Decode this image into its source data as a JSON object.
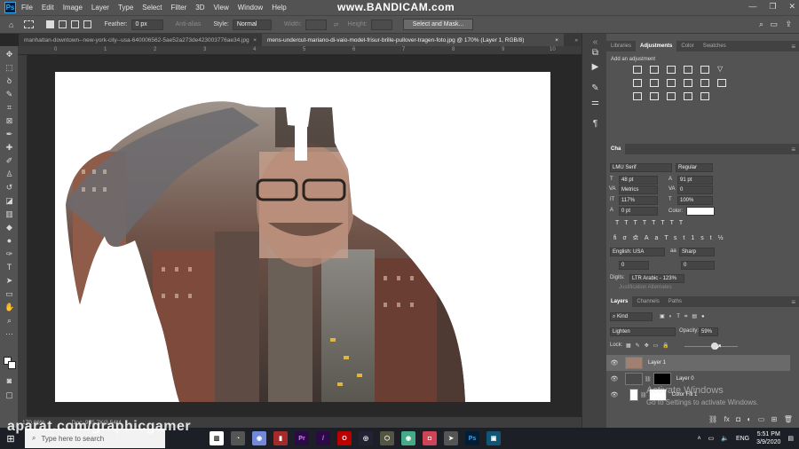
{
  "menubar": {
    "items": [
      "File",
      "Edit",
      "Image",
      "Layer",
      "Type",
      "Select",
      "Filter",
      "3D",
      "View",
      "Window",
      "Help"
    ],
    "recording_banner": "www.BANDICAM.com"
  },
  "options": {
    "feather_label": "Feather:",
    "feather_value": "0 px",
    "antialias_label": "Anti-alias",
    "style_label": "Style:",
    "style_value": "Normal",
    "width_label": "Width:",
    "height_label": "Height:",
    "select_mask_label": "Select and Mask..."
  },
  "tabs": [
    {
      "label": "manhattan-downtown--new-york-city--usa-640006562-5ae52a273de423003776ae34.jpg",
      "close": "×"
    },
    {
      "label": "mens-undercut-mariano-di-vaio-model-frisur-brille-pullover-tragen-foto.jpg @ 170% (Layer 1, RGB/8)",
      "close": "×"
    }
  ],
  "ruler": {
    "ticks": [
      "0",
      "1",
      "2",
      "3",
      "4",
      "5",
      "6",
      "7",
      "8",
      "9",
      "10"
    ]
  },
  "status": {
    "zoom": "170.86%",
    "doc": "Doc: 955.7K/3.54M"
  },
  "right_panel": {
    "top_tabs": [
      "Libraries",
      "Adjustments",
      "Color",
      "Swatches"
    ],
    "add_adjustment": "Add an adjustment",
    "character": {
      "tab": "Cha",
      "font_family": "LMU Serif",
      "font_style": "Regular",
      "size": "48 pt",
      "leading": "91 pt",
      "kerning": "Metrics",
      "tracking": "0",
      "vscale": "117%",
      "hscale": "100%",
      "baseline": "0 pt",
      "color_label": "Color:",
      "language": "English: USA",
      "antialias": "Sharp",
      "indent_a": "0",
      "indent_b": "0",
      "digits_label": "Digits:",
      "digits_value": "LTR Arabic - 123%",
      "justify": "Justification Alternates"
    },
    "layers": {
      "tabs": [
        "Layers",
        "Channels",
        "Paths"
      ],
      "filter": "Kind",
      "blend_mode": "Lighten",
      "opacity_label": "Opacity:",
      "opacity_value": "59%",
      "lock_label": "Lock:",
      "rows": [
        {
          "name": "Layer 1"
        },
        {
          "name": "Layer 0"
        },
        {
          "name": "Color Fill 1"
        }
      ]
    }
  },
  "taskbar": {
    "search_placeholder": "Type here to search",
    "language": "ENG",
    "time": "5:51 PM",
    "date": "3/9/2020"
  },
  "watermarks": {
    "activate_title": "Activate Windows",
    "activate_sub": "Go to Settings to activate Windows.",
    "aparat": "aparat.com/graphicgamer"
  },
  "colors": {
    "ui_dark": "#282828",
    "panel": "#535353",
    "accent_ps": "#31a8ff"
  }
}
